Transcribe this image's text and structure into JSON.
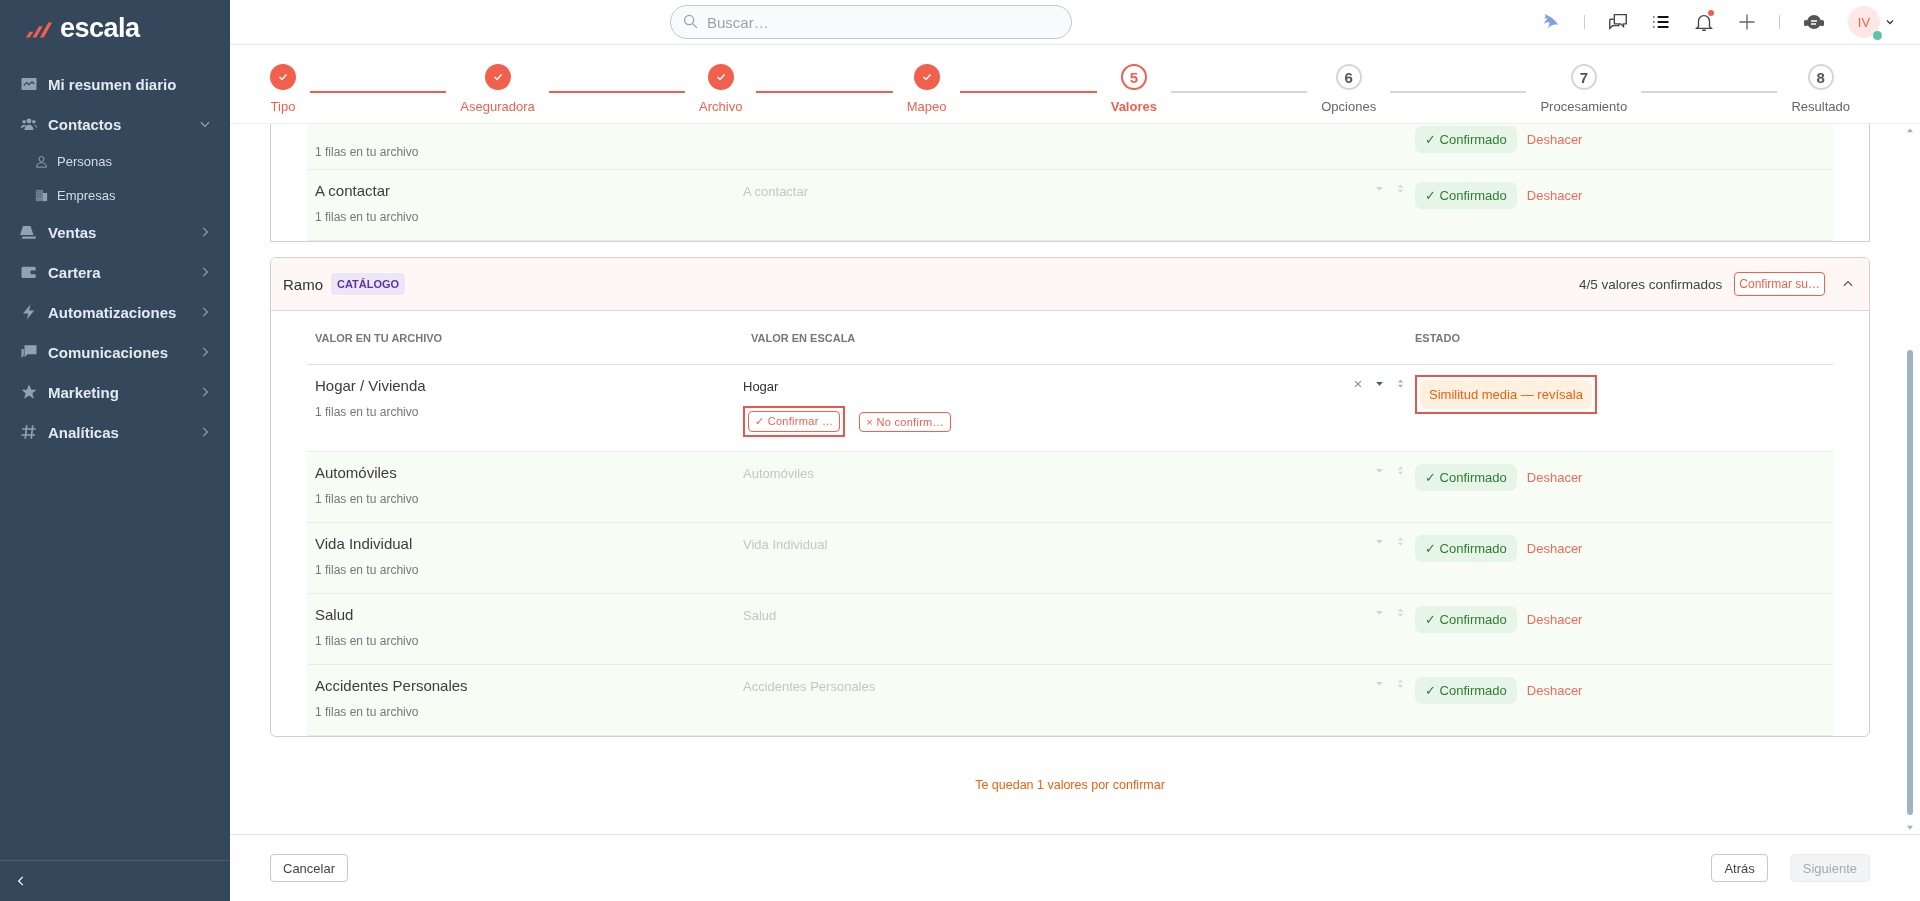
{
  "sidebar": {
    "logo": "escala",
    "items": [
      {
        "label": "Mi resumen diario"
      },
      {
        "label": "Contactos",
        "expanded": true,
        "children": [
          {
            "label": "Personas"
          },
          {
            "label": "Empresas"
          }
        ]
      },
      {
        "label": "Ventas",
        "expanded": false
      },
      {
        "label": "Cartera",
        "expanded": false
      },
      {
        "label": "Automatizaciones",
        "expanded": false
      },
      {
        "label": "Comunicaciones",
        "expanded": false
      },
      {
        "label": "Marketing",
        "expanded": false
      },
      {
        "label": "Analíticas",
        "expanded": false
      }
    ]
  },
  "topbar": {
    "search": {
      "placeholder": "Buscar…"
    },
    "notifications_unread": true,
    "avatar": {
      "initials": "IV",
      "online": true
    }
  },
  "stepper": [
    {
      "label": "Tipo",
      "done": true,
      "selected": false
    },
    {
      "label": "Aseguradora",
      "done": true,
      "selected": false
    },
    {
      "label": "Archivo",
      "done": true,
      "selected": false
    },
    {
      "label": "Mapeo",
      "done": true,
      "selected": false
    },
    {
      "label": "Valores",
      "number": "5",
      "done": false,
      "selected": true
    },
    {
      "label": "Opciones",
      "number": "6",
      "done": false,
      "selected": false
    },
    {
      "label": "Procesamiento",
      "number": "7",
      "done": false,
      "selected": false
    },
    {
      "label": "Resultado",
      "number": "8",
      "done": false,
      "selected": false
    }
  ],
  "previous_card": {
    "rows": [
      {
        "kind": "confirmed",
        "sub": "1 filas en tu archivo",
        "status": "✓ Confirmado",
        "undo": "Deshacer"
      },
      {
        "kind": "confirmed",
        "name": "A contactar",
        "sub": "1 filas en tu archivo",
        "value": "A contactar",
        "status": "✓ Confirmado",
        "undo": "Deshacer"
      }
    ]
  },
  "ramo_card": {
    "title": "Ramo",
    "badge": "CATÁLOGO",
    "summary": "4/5 valores confirmados",
    "confirm_all": "Confirmar su…",
    "expanded": true,
    "columns": [
      "VALOR EN TU ARCHIVO",
      "VALOR EN ESCALA",
      "ESTADO"
    ],
    "rows": [
      {
        "kind": "review",
        "name": "Hogar / Vivienda",
        "sub": "1 filas en tu archivo",
        "value": "Hogar",
        "confirm": "✓ Confirmar …",
        "confirm_highlighted": true,
        "reject": "× No confirm…",
        "status": "Similitud media — revísala",
        "status_highlighted": true
      },
      {
        "kind": "confirmed",
        "name": "Automóviles",
        "sub": "1 filas en tu archivo",
        "value": "Automóviles",
        "status": "✓ Confirmado",
        "undo": "Deshacer"
      },
      {
        "kind": "confirmed",
        "name": "Vida Individual",
        "sub": "1 filas en tu archivo",
        "value": "Vida Individual",
        "status": "✓ Confirmado",
        "undo": "Deshacer"
      },
      {
        "kind": "confirmed",
        "name": "Salud",
        "sub": "1 filas en tu archivo",
        "value": "Salud",
        "status": "✓ Confirmado",
        "undo": "Deshacer"
      },
      {
        "kind": "confirmed",
        "name": "Accidentes Personales",
        "sub": "1 filas en tu archivo",
        "value": "Accidentes Personales",
        "status": "✓ Confirmado",
        "undo": "Deshacer"
      }
    ]
  },
  "message": "Te quedan 1 valores por confirmar",
  "footer": {
    "cancel": "Cancelar",
    "back": "Atrás",
    "next": {
      "label": "Siguiente",
      "disabled": true
    }
  }
}
